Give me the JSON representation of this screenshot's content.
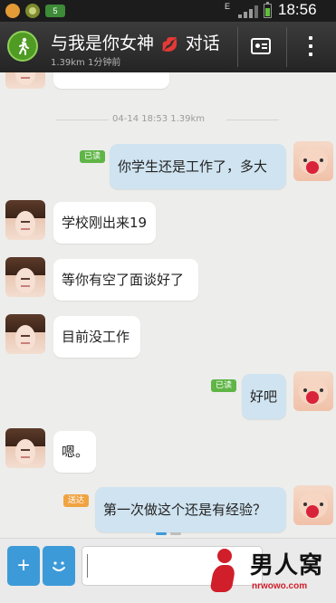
{
  "status_bar": {
    "time": "18:56",
    "badge": "5"
  },
  "header": {
    "title_left": "与我是你女神",
    "title_right": "对话",
    "lip_icon": "lips-icon",
    "subtitle": "1.39km 1分钟前"
  },
  "chat": {
    "timestamp": "04-14 18:53  1.39km",
    "messages": [
      {
        "side": "me",
        "text": "你学生还是工作了，多大",
        "status": "已读"
      },
      {
        "side": "other",
        "text": "学校刚出来19"
      },
      {
        "side": "other",
        "text": "等你有空了面谈好了"
      },
      {
        "side": "other",
        "text": "目前没工作"
      },
      {
        "side": "me",
        "text": "好吧",
        "status": "已读"
      },
      {
        "side": "other",
        "text": "嗯。"
      },
      {
        "side": "me",
        "text": "第一次做这个还是有经验？",
        "status": "送达"
      }
    ]
  },
  "input_bar": {
    "plus_label": "+",
    "emoji_icon": "smile-icon"
  },
  "watermark": {
    "text": "男人窝",
    "url": "nrwowo.com"
  }
}
